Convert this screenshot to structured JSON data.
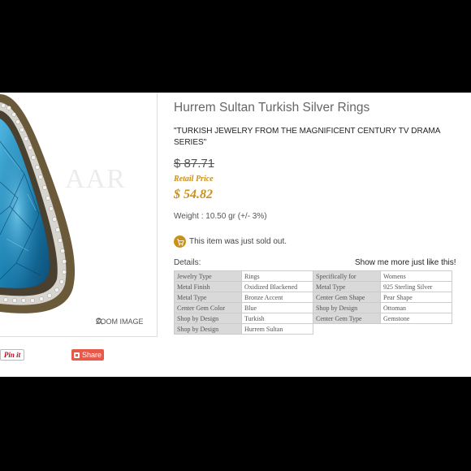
{
  "product": {
    "title": "Hurrem Sultan Turkish Silver Rings",
    "subtitle": "\"TURKISH JEWELRY FROM THE MAGNIFICENT CENTURY TV DRAMA SERIES\"",
    "old_price": "$ 87.71",
    "retail_label": "Retail Price",
    "price": "$ 54.82",
    "weight": "Weight : 10.50 gr (+/- 3%)",
    "sold_text": "This item was just sold out."
  },
  "image": {
    "watermark": "AAR",
    "zoom_label": "ZOOM IMAGE"
  },
  "social": {
    "pinit_label": "Pin it",
    "share_label": "Share"
  },
  "details": {
    "label": "Details:",
    "more_link": "Show me more just like this!",
    "rows": [
      {
        "k1": "Jewelry Type",
        "v1": "Rings",
        "k2": "Specifically for",
        "v2": "Womens"
      },
      {
        "k1": "Metal Finish",
        "v1": "Oxidized Blackened",
        "k2": "Metal Type",
        "v2": "925 Sterling Silver"
      },
      {
        "k1": "Metal Type",
        "v1": "Bronze Accent",
        "k2": "Center Gem Shape",
        "v2": "Pear Shape"
      },
      {
        "k1": "Center Gem Color",
        "v1": "Blue",
        "k2": "Shop by Design",
        "v2": "Ottoman"
      },
      {
        "k1": "Shop by Design",
        "v1": "Turkish",
        "k2": "Center Gem Type",
        "v2": "Gemstone"
      },
      {
        "k1": "Shop by Design",
        "v1": "Hurrem Sultan"
      }
    ]
  },
  "colors": {
    "accent_gold": "#c9901e",
    "share_red": "#e8594a",
    "gem_blue": "#1a7fb0"
  }
}
